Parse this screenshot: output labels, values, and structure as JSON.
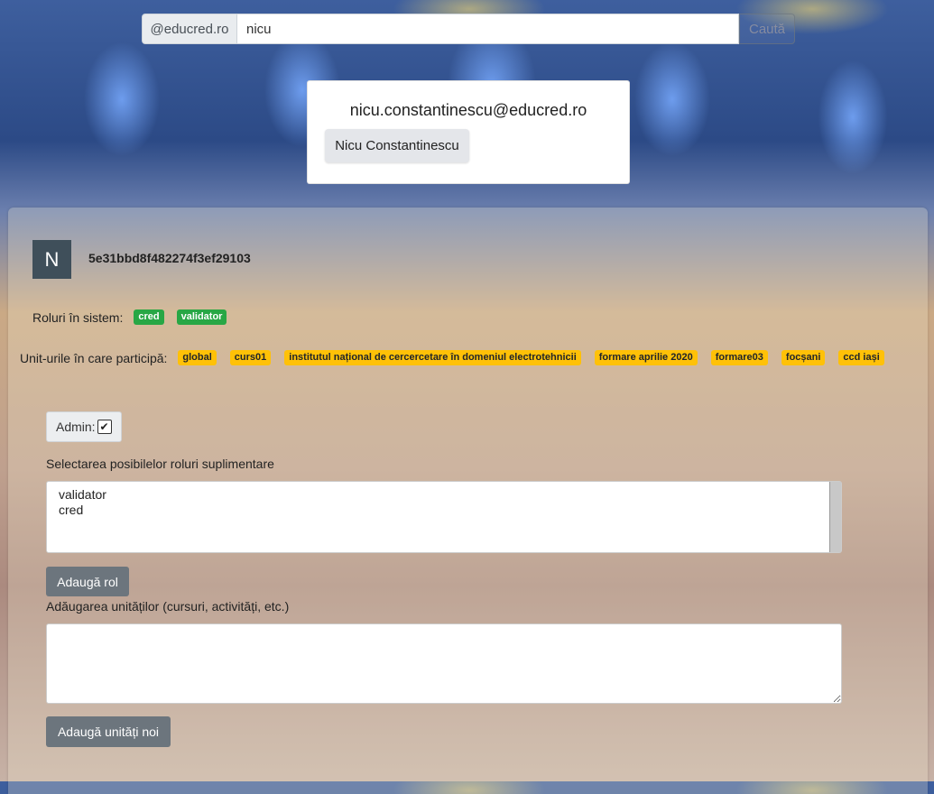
{
  "search": {
    "domain_prefix": "@educred.ro",
    "value": "nicu",
    "button_label": "Caută"
  },
  "result": {
    "email": "nicu.constantinescu@educred.ro",
    "name": "Nicu Constantinescu"
  },
  "user": {
    "avatar_letter": "N",
    "id": "5e31bbd8f482274f3ef29103",
    "roles_label": "Roluri în sistem:",
    "roles": [
      "cred",
      "validator"
    ],
    "units_label": "Unit-urile în care participă:",
    "units": [
      "global",
      "curs01",
      "institutul național de cercercetare în domeniul electrotehnicii",
      "formare aprilie 2020",
      "formare03",
      "focșani",
      "ccd iași"
    ]
  },
  "admin": {
    "label": "Admin:",
    "checked": true
  },
  "roles_select": {
    "label": "Selectarea posibilelor roluri suplimentare",
    "options": [
      "validator",
      "cred"
    ]
  },
  "add_role_button": "Adaugă rol",
  "units_add": {
    "label": "Adăugarea unităților (cursuri, activități, etc.)",
    "value": "",
    "button_label": "Adaugă unități noi"
  },
  "colors": {
    "role_badge": "#28a745",
    "unit_badge": "#ffc107",
    "secondary_button": "#6c757d",
    "avatar_bg": "#3f4f5a"
  }
}
